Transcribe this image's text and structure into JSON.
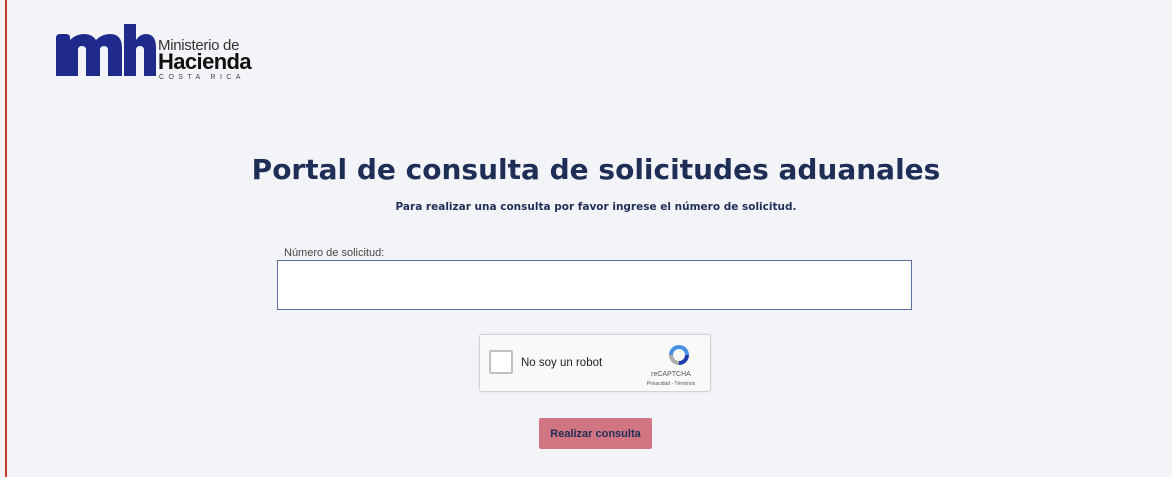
{
  "logo": {
    "line1": "Ministerio de",
    "line2": "Hacienda",
    "line3": "COSTA RICA"
  },
  "main": {
    "title": "Portal de consulta de solicitudes aduanales",
    "subtitle": "Para realizar una consulta por favor ingrese el número de solicitud."
  },
  "form": {
    "field_label": "Número de solicitud:",
    "field_value": "",
    "field_placeholder": "",
    "submit_label": "Realizar consulta"
  },
  "captcha": {
    "label": "No soy un robot",
    "brand": "reCAPTCHA",
    "links": "Privacidad - Términos"
  },
  "colors": {
    "background": "#f3f4f7",
    "heading": "#1f2e57",
    "logo_blue": "#1f2a8c",
    "left_accent": "#c0392b",
    "button": "#d17582"
  }
}
